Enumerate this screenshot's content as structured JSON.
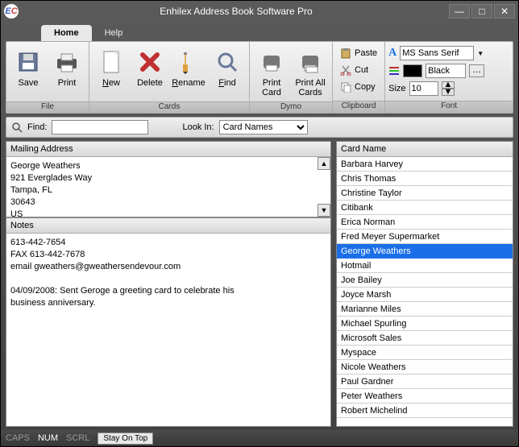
{
  "title": "Enhilex Address Book Software Pro",
  "tabs": {
    "home": "Home",
    "help": "Help"
  },
  "ribbon": {
    "file": {
      "save": "Save",
      "print": "Print",
      "group": "File"
    },
    "cards": {
      "new": "New",
      "delete": "Delete",
      "rename": "Rename",
      "find": "Find",
      "group": "Cards"
    },
    "dymo": {
      "printcard": "Print\nCard",
      "printall": "Print All\nCards",
      "group": "Dymo"
    },
    "clipboard": {
      "paste": "Paste",
      "cut": "Cut",
      "copy": "Copy",
      "group": "Clipboard"
    },
    "font": {
      "name": "MS Sans Serif",
      "color": "Black",
      "sizelabel": "Size",
      "size": "10",
      "group": "Font"
    }
  },
  "findbar": {
    "label": "Find:",
    "value": "",
    "lookin_label": "Look In:",
    "lookin_value": "Card Names"
  },
  "address": {
    "title": "Mailing Address",
    "lines": [
      "George Weathers",
      "921 Everglades Way",
      "Tampa, FL",
      "30643",
      "US"
    ]
  },
  "notes": {
    "title": "Notes",
    "lines": [
      "613-442-7654",
      "FAX 613-442-7678",
      "email gweathers@gweathersendevour.com",
      "",
      "04/09/2008: Sent Geroge a greeting card to celebrate his",
      "business anniversary."
    ]
  },
  "cardlist": {
    "header": "Card Name",
    "selected": "George Weathers",
    "items": [
      "Barbara Harvey",
      "Chris Thomas",
      "Christine Taylor",
      "Citibank",
      "Erica Norman",
      "Fred Meyer Supermarket",
      "George Weathers",
      "Hotmail",
      "Joe Bailey",
      "Joyce Marsh",
      "Marianne Miles",
      "Michael Spurling",
      "Microsoft Sales",
      "Myspace",
      "Nicole Weathers",
      "Paul Gardner",
      "Peter Weathers",
      "Robert Michelind"
    ]
  },
  "status": {
    "caps": "CAPS",
    "num": "NUM",
    "scrl": "SCRL",
    "stay": "Stay On Top"
  }
}
